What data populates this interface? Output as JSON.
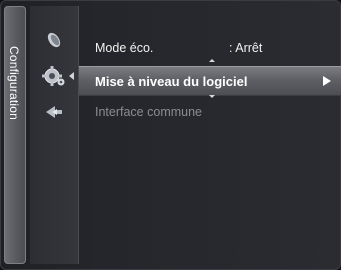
{
  "side_tab": {
    "label": "Configuration"
  },
  "icons": [
    {
      "name": "picture-icon"
    },
    {
      "name": "setup-gear-icon"
    },
    {
      "name": "input-icon"
    }
  ],
  "menu": {
    "items": [
      {
        "label": "Mode éco.",
        "value": ": Arrêt",
        "state": "normal"
      },
      {
        "label": "Mise à niveau du logiciel",
        "value": "",
        "state": "selected"
      },
      {
        "label": "Interface commune",
        "value": "",
        "state": "disabled"
      }
    ]
  },
  "colors": {
    "background": "#24262b",
    "highlight": "#5e6066",
    "text": "#f2f2f2",
    "disabled_text": "#8a8c91"
  }
}
